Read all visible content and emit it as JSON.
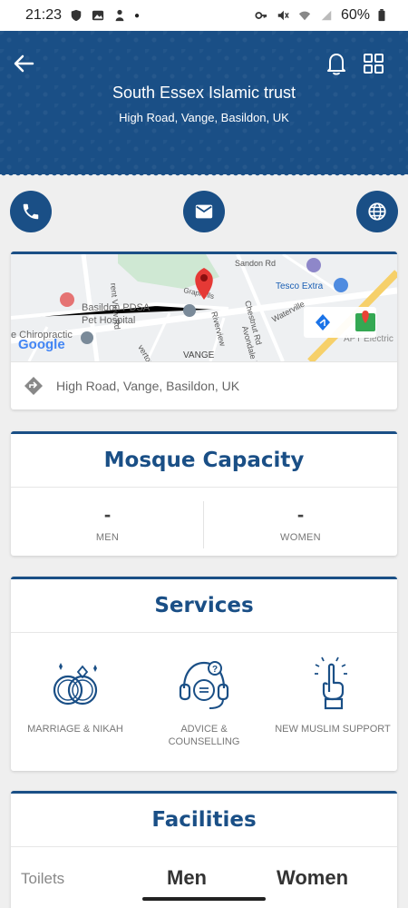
{
  "status_bar": {
    "time": "21:23",
    "battery": "60%"
  },
  "header": {
    "title": "South Essex Islamic trust",
    "address": "High Road, Vange, Basildon, UK",
    "bg_color": "#1a4f86"
  },
  "contact_buttons": [
    "phone-icon",
    "mail-icon",
    "globe-icon"
  ],
  "map": {
    "labels": {
      "sandon": "Sandon Rd",
      "tesco": "Tesco Extra",
      "view_rd": "rent View Rd",
      "grapnells": "Grapnells",
      "vet1": "Basildon PDSA",
      "vet2": "Pet Hospital",
      "chestnut": "Chestnut Rd",
      "waterville": "Waterville",
      "chiro": "e Chiropractic",
      "riverview": "Riverview",
      "avondale": "Avondale Rd",
      "vange": "VANGE",
      "overtons": "vertons",
      "apt": "APT Electric",
      "google": "Google"
    },
    "address": "High Road, Vange, Basildon, UK"
  },
  "capacity": {
    "title": "Mosque Capacity",
    "men_value": "-",
    "men_label": "MEN",
    "women_value": "-",
    "women_label": "WOMEN"
  },
  "services": {
    "title": "Services",
    "items": [
      {
        "label": "MARRIAGE & NIKAH",
        "icon": "rings-icon"
      },
      {
        "label": "ADVICE & COUNSELLING",
        "icon": "headset-icon"
      },
      {
        "label": "NEW MUSLIM SUPPORT",
        "icon": "raised-finger-icon"
      }
    ]
  },
  "facilities": {
    "title": "Facilities",
    "row_label": "Toilets",
    "col_men": "Men",
    "col_women": "Women"
  }
}
